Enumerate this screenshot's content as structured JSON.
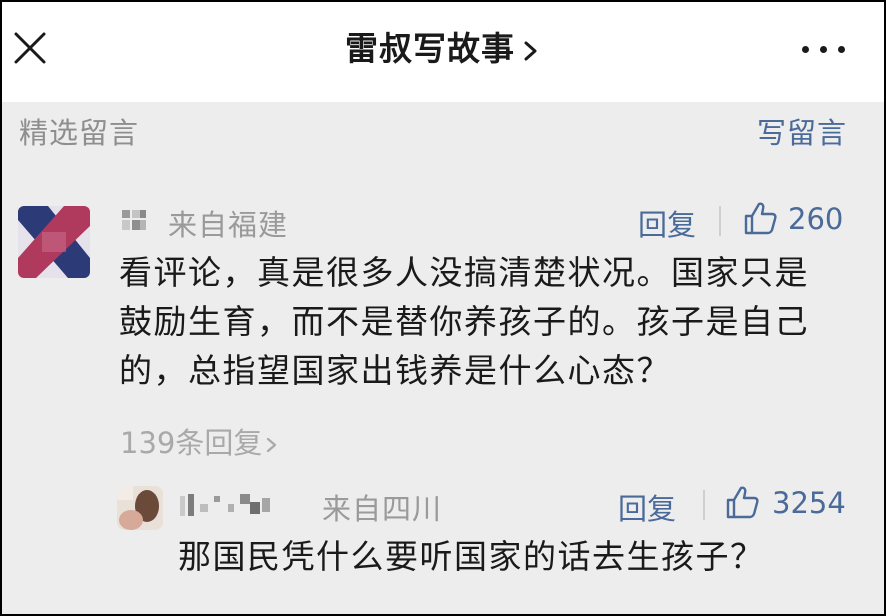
{
  "header": {
    "title": "雷叔写故事",
    "chevron_icon": "chevron-right-icon",
    "close_icon": "close-icon",
    "more_icon": "more-dots-icon"
  },
  "section": {
    "label": "精选留言",
    "write_label": "写留言"
  },
  "comments": [
    {
      "location": "来自福建",
      "reply_label": "回复",
      "likes": "260",
      "text": "看评论，真是很多人没搞清楚状况。国家只是鼓励生育，而不是替你养孩子的。孩子是自己的，总指望国家出钱养是什么心态？",
      "replies_link": "139条回复"
    },
    {
      "location": "来自四川",
      "reply_label": "回复",
      "likes": "3254",
      "text": "那国民凭什么要听国家的话去生孩子？"
    }
  ],
  "colors": {
    "accent": "#4a6a9a",
    "muted": "#9a9a9a",
    "background": "#ededed"
  }
}
